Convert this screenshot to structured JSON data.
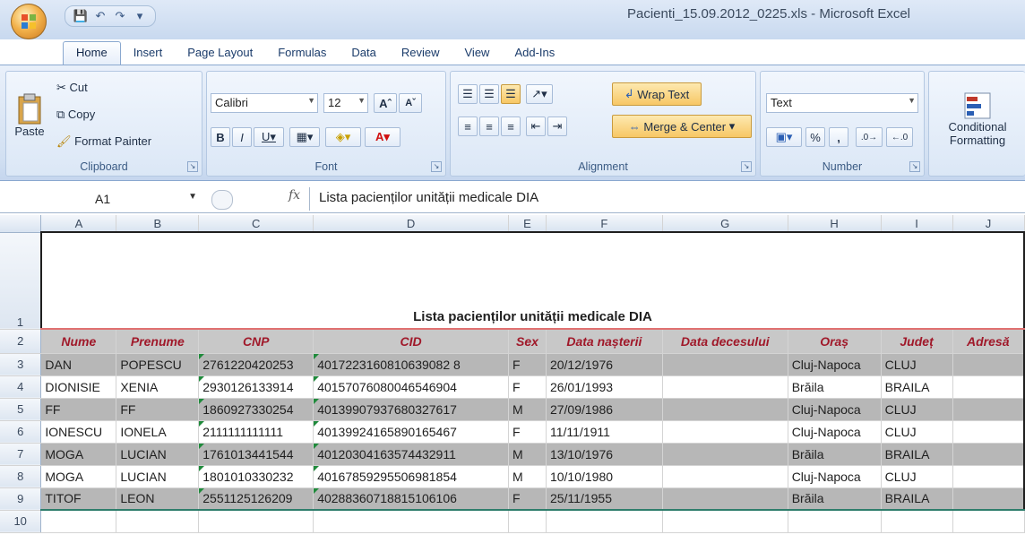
{
  "window": {
    "title": "Pacienti_15.09.2012_0225.xls - Microsoft Excel"
  },
  "tabs": [
    "Home",
    "Insert",
    "Page Layout",
    "Formulas",
    "Data",
    "Review",
    "View",
    "Add-Ins"
  ],
  "ribbon": {
    "clipboard": {
      "label": "Clipboard",
      "paste": "Paste",
      "cut": "Cut",
      "copy": "Copy",
      "format_painter": "Format Painter"
    },
    "font": {
      "label": "Font",
      "font_name": "Calibri",
      "font_size": "12"
    },
    "alignment": {
      "label": "Alignment",
      "wrap_text": "Wrap Text",
      "merge_center": "Merge & Center"
    },
    "number": {
      "label": "Number",
      "format": "Text"
    },
    "styles": {
      "conditional_formatting_1": "Conditional",
      "conditional_formatting_2": "Formatting"
    }
  },
  "formula_bar": {
    "name_box": "A1",
    "fx": "fx",
    "content": "Lista pacienților unității medicale DIA"
  },
  "sheet": {
    "columns": [
      "A",
      "B",
      "C",
      "D",
      "E",
      "F",
      "G",
      "H",
      "I",
      "J"
    ],
    "rows": [
      {
        "num": "1",
        "title": "Lista pacienților unității medicale DIA"
      },
      {
        "num": "2",
        "cells": [
          "Nume",
          "Prenume",
          "CNP",
          "CID",
          "Sex",
          "Data nașterii",
          "Data decesului",
          "Oraș",
          "Județ",
          "Adresă"
        ]
      },
      {
        "num": "3",
        "cells": [
          "DAN",
          "POPESCU",
          "2761220420253",
          "4017223160810639082 8",
          "F",
          "20/12/1976",
          "",
          "Cluj-Napoca",
          "CLUJ",
          ""
        ]
      },
      {
        "num": "4",
        "cells": [
          "DIONISIE",
          "XENIA",
          "2930126133914",
          "40157076080046546904",
          "F",
          "26/01/1993",
          "",
          "Brăila",
          "BRAILA",
          ""
        ]
      },
      {
        "num": "5",
        "cells": [
          "FF",
          "FF",
          "1860927330254",
          "40139907937680327617",
          "M",
          "27/09/1986",
          "",
          "Cluj-Napoca",
          "CLUJ",
          ""
        ]
      },
      {
        "num": "6",
        "cells": [
          "IONESCU",
          "IONELA",
          "2111111111111",
          "40139924165890165467",
          "F",
          "11/11/1911",
          "",
          "Cluj-Napoca",
          "CLUJ",
          ""
        ]
      },
      {
        "num": "7",
        "cells": [
          "MOGA",
          "LUCIAN",
          "1761013441544",
          "40120304163574432911",
          "M",
          "13/10/1976",
          "",
          "Brăila",
          "BRAILA",
          ""
        ]
      },
      {
        "num": "8",
        "cells": [
          "MOGA",
          "LUCIAN",
          "1801010330232",
          "40167859295506981854",
          "M",
          "10/10/1980",
          "",
          "Cluj-Napoca",
          "CLUJ",
          ""
        ]
      },
      {
        "num": "9",
        "cells": [
          "TITOF",
          "LEON",
          "2551125126209",
          "40288360718815106106",
          "F",
          "25/11/1955",
          "",
          "Brăila",
          "BRAILA",
          ""
        ]
      },
      {
        "num": "10",
        "cells": [
          "",
          "",
          "",
          "",
          "",
          "",
          "",
          "",
          "",
          ""
        ]
      }
    ]
  }
}
